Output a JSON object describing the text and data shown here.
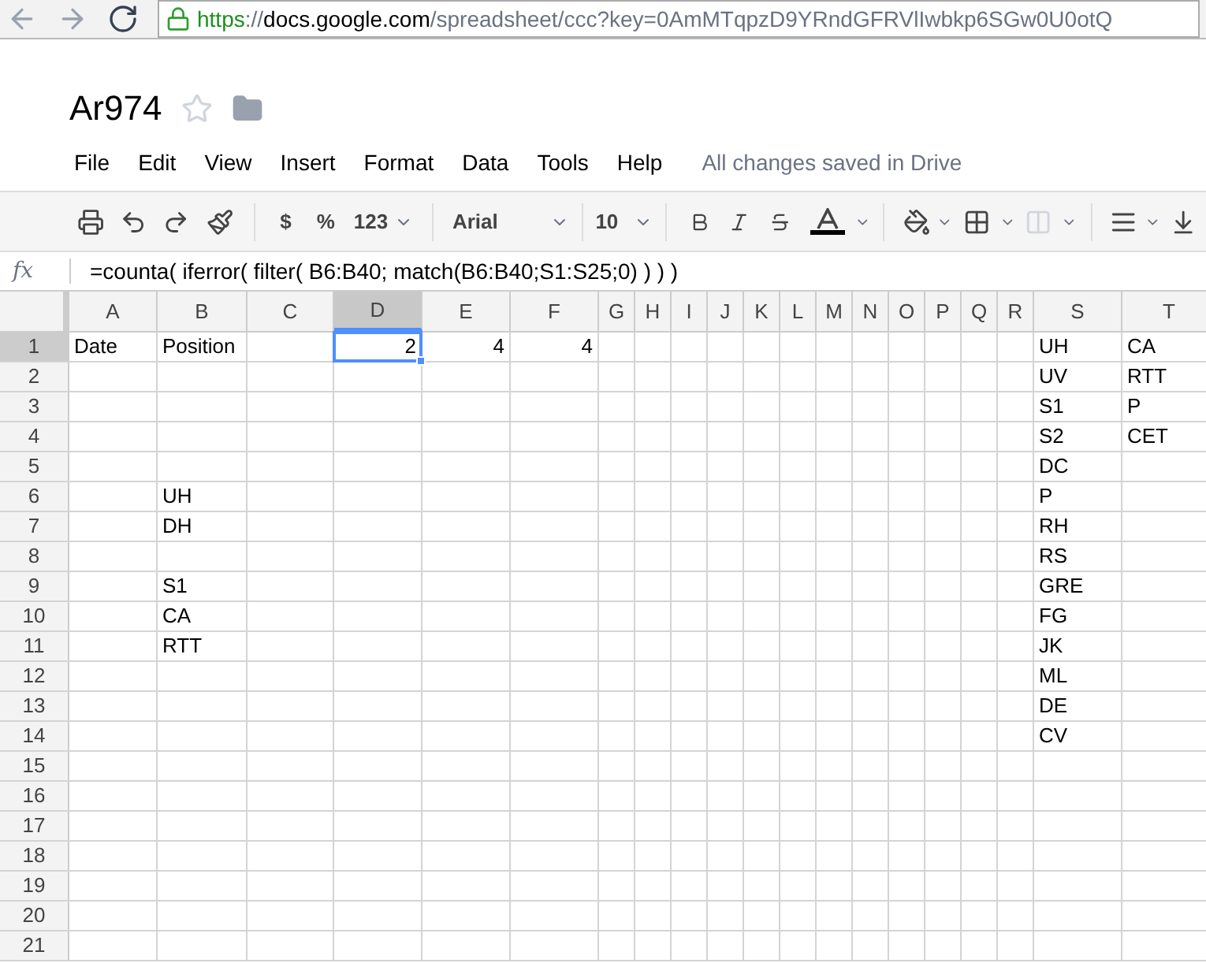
{
  "browser": {
    "url": {
      "scheme": "https",
      "separator": "://",
      "host": "docs.google.com",
      "path": "/spreadsheet/ccc?key=0AmMTqpzD9YRndGFRVlIwbkp6SGw0U0otQ"
    }
  },
  "document": {
    "title": "Ar974",
    "starred": false
  },
  "menu": [
    "File",
    "Edit",
    "View",
    "Insert",
    "Format",
    "Data",
    "Tools",
    "Help"
  ],
  "save_status": "All changes saved in Drive",
  "toolbar": {
    "currency": "$",
    "percent": "%",
    "number_format": "123",
    "font": "Arial",
    "font_size": "10"
  },
  "formula_bar": {
    "label": "fx",
    "formula": "=counta( iferror( filter( B6:B40; match(B6:B40;S1:S25;0) ) ) )"
  },
  "columns": [
    {
      "label": "A",
      "selected": false
    },
    {
      "label": "B",
      "selected": false
    },
    {
      "label": "C",
      "selected": false
    },
    {
      "label": "D",
      "selected": true
    },
    {
      "label": "E",
      "selected": false
    },
    {
      "label": "F",
      "selected": false
    },
    {
      "label": "G",
      "selected": false
    },
    {
      "label": "H",
      "selected": false
    },
    {
      "label": "I",
      "selected": false
    },
    {
      "label": "J",
      "selected": false
    },
    {
      "label": "K",
      "selected": false
    },
    {
      "label": "L",
      "selected": false
    },
    {
      "label": "M",
      "selected": false
    },
    {
      "label": "N",
      "selected": false
    },
    {
      "label": "O",
      "selected": false
    },
    {
      "label": "P",
      "selected": false
    },
    {
      "label": "Q",
      "selected": false
    },
    {
      "label": "R",
      "selected": false
    },
    {
      "label": "S",
      "selected": false
    },
    {
      "label": "T",
      "selected": false
    }
  ],
  "rows": [
    {
      "number": "1",
      "selected": true,
      "cells": {
        "0": {
          "text": "Date",
          "kind": "text"
        },
        "1": {
          "text": "Position",
          "kind": "text"
        },
        "3": {
          "text": "2",
          "kind": "number"
        },
        "4": {
          "text": "4",
          "kind": "number"
        },
        "5": {
          "text": "4",
          "kind": "number"
        },
        "18": {
          "text": "UH",
          "kind": "text"
        },
        "19": {
          "text": "CA",
          "kind": "text"
        }
      }
    },
    {
      "number": "2",
      "selected": false,
      "cells": {
        "18": {
          "text": "UV",
          "kind": "text"
        },
        "19": {
          "text": "RTT",
          "kind": "text"
        }
      }
    },
    {
      "number": "3",
      "selected": false,
      "cells": {
        "18": {
          "text": "S1",
          "kind": "text"
        },
        "19": {
          "text": "P",
          "kind": "text"
        }
      }
    },
    {
      "number": "4",
      "selected": false,
      "cells": {
        "18": {
          "text": "S2",
          "kind": "text"
        },
        "19": {
          "text": "CET",
          "kind": "text"
        }
      }
    },
    {
      "number": "5",
      "selected": false,
      "cells": {
        "18": {
          "text": "DC",
          "kind": "text"
        }
      }
    },
    {
      "number": "6",
      "selected": false,
      "cells": {
        "1": {
          "text": "UH",
          "kind": "text"
        },
        "18": {
          "text": "P",
          "kind": "text"
        }
      }
    },
    {
      "number": "7",
      "selected": false,
      "cells": {
        "1": {
          "text": "DH",
          "kind": "text"
        },
        "18": {
          "text": "RH",
          "kind": "text"
        }
      }
    },
    {
      "number": "8",
      "selected": false,
      "cells": {
        "18": {
          "text": "RS",
          "kind": "text"
        }
      }
    },
    {
      "number": "9",
      "selected": false,
      "cells": {
        "1": {
          "text": "S1",
          "kind": "text"
        },
        "18": {
          "text": "GRE",
          "kind": "text"
        }
      }
    },
    {
      "number": "10",
      "selected": false,
      "cells": {
        "1": {
          "text": "CA",
          "kind": "text"
        },
        "18": {
          "text": "FG",
          "kind": "text"
        }
      }
    },
    {
      "number": "11",
      "selected": false,
      "cells": {
        "1": {
          "text": "RTT",
          "kind": "text"
        },
        "18": {
          "text": "JK",
          "kind": "text"
        }
      }
    },
    {
      "number": "12",
      "selected": false,
      "cells": {
        "18": {
          "text": "ML",
          "kind": "text"
        }
      }
    },
    {
      "number": "13",
      "selected": false,
      "cells": {
        "18": {
          "text": "DE",
          "kind": "text"
        }
      }
    },
    {
      "number": "14",
      "selected": false,
      "cells": {
        "18": {
          "text": "CV",
          "kind": "text"
        }
      }
    },
    {
      "number": "15",
      "selected": false,
      "cells": {}
    },
    {
      "number": "16",
      "selected": false,
      "cells": {}
    },
    {
      "number": "17",
      "selected": false,
      "cells": {}
    },
    {
      "number": "18",
      "selected": false,
      "cells": {}
    },
    {
      "number": "19",
      "selected": false,
      "cells": {}
    },
    {
      "number": "20",
      "selected": false,
      "cells": {}
    },
    {
      "number": "21",
      "selected": false,
      "cells": {}
    }
  ]
}
